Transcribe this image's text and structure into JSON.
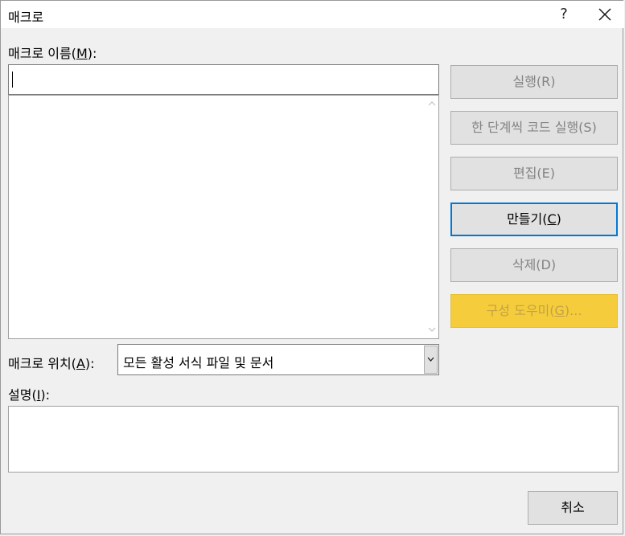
{
  "window": {
    "title": "매크로",
    "help_label": "?",
    "icons": {
      "close": "close-icon"
    }
  },
  "macro_name": {
    "label_main": "매크로 이름(",
    "label_key": "M",
    "label_end": "):",
    "value": ""
  },
  "macro_list": {
    "items": []
  },
  "location": {
    "label_main": "매크로 위치(",
    "label_key": "A",
    "label_end": "):",
    "selected": "모든 활성 서식 파일 및 문서"
  },
  "description": {
    "label_main": "설명(",
    "label_key": "I",
    "label_end": "):",
    "value": ""
  },
  "buttons": {
    "run": {
      "main": "실행(",
      "key": "R",
      "end": ")",
      "enabled": false
    },
    "step": {
      "main": "한 단계씩 코드 실행(",
      "key": "S",
      "end": ")",
      "enabled": false
    },
    "edit": {
      "main": "편집(",
      "key": "E",
      "end": ")",
      "enabled": false
    },
    "create": {
      "main": "만들기(",
      "key": "C",
      "end": ")",
      "enabled": true
    },
    "delete": {
      "main": "삭제(",
      "key": "D",
      "end": ")",
      "enabled": false
    },
    "wizard": {
      "main": "구성 도우미(",
      "key": "G",
      "end": ")...",
      "enabled": false
    },
    "cancel": {
      "label": "취소",
      "enabled": true
    }
  },
  "colors": {
    "default_button_border": "#0078d7",
    "wizard_button": "#f5cd3c",
    "disabled_text": "#838383"
  }
}
